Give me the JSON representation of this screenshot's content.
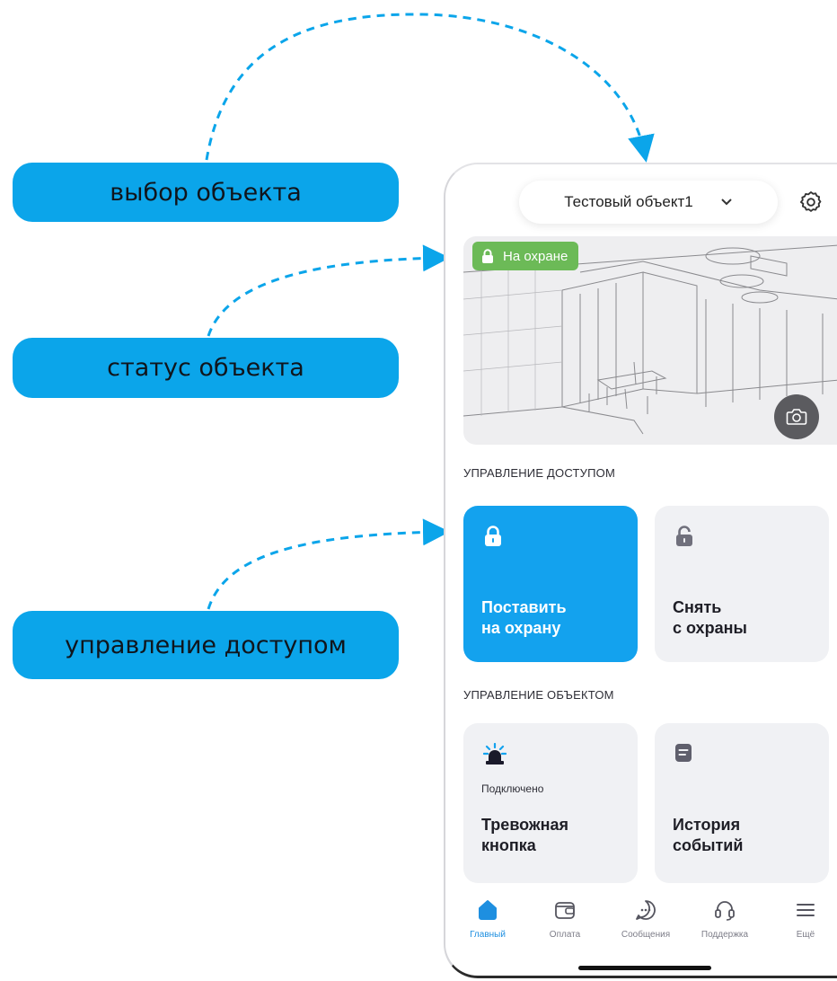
{
  "annotations": {
    "select_object": "выбор объекта",
    "object_status": "статус объекта",
    "access_control": "управление доступом"
  },
  "header": {
    "object_name": "Тестовый объект1",
    "select_icon": "chevron-down-icon",
    "settings_icon": "gear-icon"
  },
  "hero": {
    "status": "На охране",
    "status_color": "#6cba57",
    "camera_icon": "camera-icon"
  },
  "access": {
    "section_title": "УПРАВЛЕНИЕ ДОСТУПОМ",
    "arm": {
      "line1": "Поставить",
      "line2": "на охрану",
      "icon": "lock-icon",
      "color": "#13a2ee"
    },
    "disarm": {
      "line1": "Снять",
      "line2": "с охраны",
      "icon": "unlock-icon"
    }
  },
  "object_control": {
    "section_title": "УПРАВЛЕНИЕ ОБЪЕКТОМ",
    "panic": {
      "status": "Подключено",
      "line1": "Тревожная",
      "line2": "кнопка",
      "icon": "siren-icon"
    },
    "history": {
      "line1": "История",
      "line2": "событий",
      "icon": "document-icon"
    }
  },
  "tabbar": {
    "items": [
      {
        "label": "Главный",
        "icon": "home-icon",
        "active": true
      },
      {
        "label": "Оплата",
        "icon": "wallet-icon"
      },
      {
        "label": "Сообщения",
        "icon": "chat-icon"
      },
      {
        "label": "Поддержка",
        "icon": "headset-icon"
      },
      {
        "label": "Ещё",
        "icon": "menu-icon"
      }
    ],
    "active_color": "#1e8fe0"
  }
}
